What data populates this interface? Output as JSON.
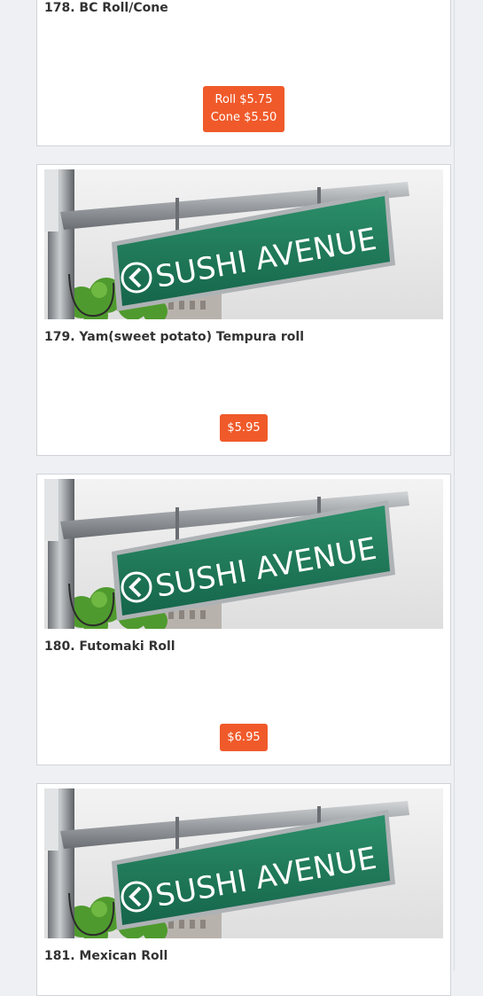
{
  "colors": {
    "accent": "#f05a2a",
    "sign_green": "#1f7a5a",
    "page_bg": "#eef0f3"
  },
  "items": [
    {
      "number_name": "178. BC Roll/Cone",
      "prices": [
        "Roll $5.75",
        "Cone $5.50"
      ],
      "has_image": false
    },
    {
      "number_name": "179. Yam(sweet potato) Tempura roll",
      "prices": [
        "$5.95"
      ],
      "has_image": true
    },
    {
      "number_name": "180. Futomaki Roll",
      "prices": [
        "$6.95"
      ],
      "has_image": true
    },
    {
      "number_name": "181. Mexican Roll",
      "prices": [],
      "has_image": true
    }
  ],
  "image_sign_text": "SUSHI AVENUE"
}
